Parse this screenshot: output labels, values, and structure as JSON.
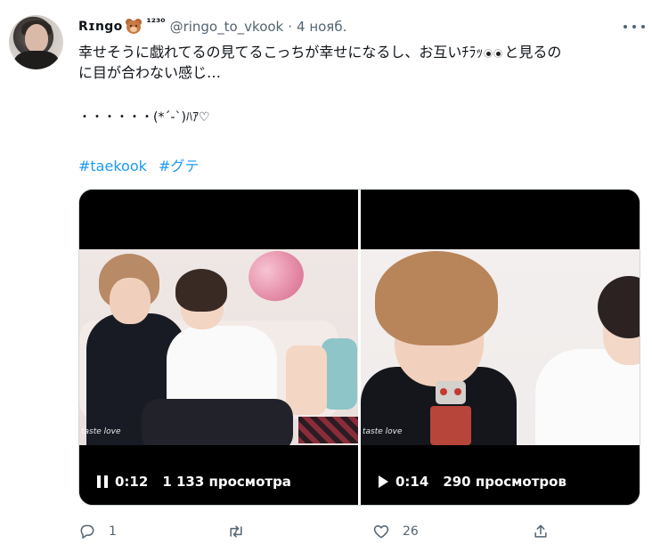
{
  "tweet": {
    "author": {
      "display_name": "Rɪngo",
      "emoji_icon": "bear-face-icon",
      "name_suffix": "¹²³⁰",
      "handle": "@ringo_to_vkook",
      "separator": "·",
      "time": "4 нояб."
    },
    "text_line1": "幸せそうに戯れてるの見てるこっちが幸せになるし、お互いﾁﾗｯ",
    "text_line1_after": "と見るの",
    "text_line2": "に目が合わない感じ…",
    "text_line3": "・・・・・・(*´-`)ﾊｱ♡",
    "hashtags": [
      "#taekook",
      "#グテ"
    ],
    "media": [
      {
        "state": "pause",
        "icon": "pause-icon",
        "time": "0:12",
        "views": "1 133 просмотра",
        "watermark": "taste love"
      },
      {
        "state": "play",
        "icon": "play-icon",
        "time": "0:14",
        "views": "290 просмотров",
        "watermark": "taste love"
      }
    ],
    "actions": {
      "reply_count": "1",
      "retweet_count": "",
      "like_count": "26"
    }
  },
  "colors": {
    "text": "#0f1419",
    "secondary": "#536471",
    "link": "#1d9bf0",
    "border": "#cfd9de"
  }
}
